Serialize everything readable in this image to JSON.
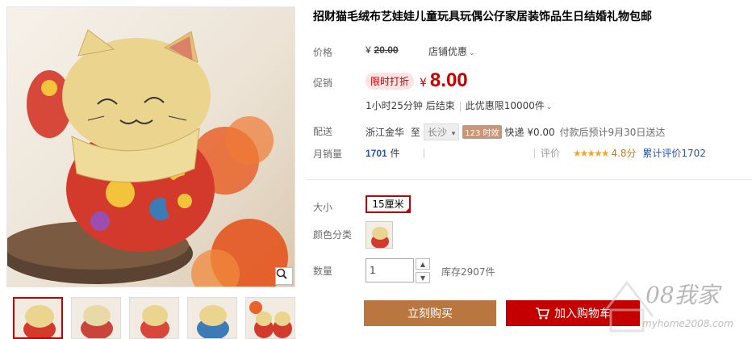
{
  "product": {
    "title": "招财猫毛绒布艺娃娃儿童玩具玩偶公仔家居装饰品生日结婚礼物包邮"
  },
  "price_row": {
    "label": "价格",
    "yen": "¥",
    "original_price": "20.00",
    "shop_discount": "店铺优惠"
  },
  "promo_row": {
    "label": "促销",
    "badge": "限时打折",
    "yen": "¥",
    "promo_price": "8.00",
    "countdown": "1小时25分钟 后结束",
    "limit": "此优惠限10000件"
  },
  "shipping_row": {
    "label": "配送",
    "from": "浙江金华",
    "to_word": "至",
    "destination": "长沙",
    "speed_tag": "123 时效",
    "express": "快递 ¥0.00",
    "eta": "付款后预计9月30日送达"
  },
  "sales_row": {
    "label": "月销量",
    "count": "1701",
    "unit": "件",
    "rating_label": "评价",
    "stars": "★★★★★",
    "score": "4.8分",
    "review_link": "累计评价1702"
  },
  "size_row": {
    "label": "大小",
    "option": "15厘米"
  },
  "color_row": {
    "label": "颜色分类"
  },
  "qty_row": {
    "label": "数量",
    "value": "1",
    "stock": "库存2907件"
  },
  "actions": {
    "buy_now": "立刻购买",
    "add_cart": "加入购物车"
  },
  "watermark": {
    "main": "08我家",
    "sub": "myhome2008.com"
  },
  "colors": {
    "accent_red": "#c40000",
    "buy_brown": "#b9773f"
  },
  "icons": [
    "zoom-icon",
    "cart-icon",
    "caret-down-icon",
    "up-arrow-icon",
    "down-arrow-icon"
  ]
}
